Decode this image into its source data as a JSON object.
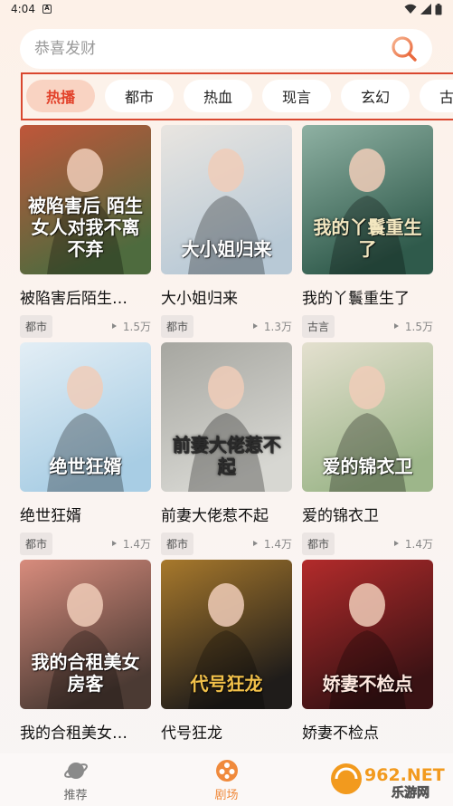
{
  "status_bar": {
    "time": "4:04"
  },
  "search": {
    "placeholder": "恭喜发财"
  },
  "tabs": [
    "热播",
    "都市",
    "热血",
    "现言",
    "玄幻",
    "古言"
  ],
  "dramas": [
    {
      "title": "被陷害后陌生…",
      "tag": "都市",
      "plays": "1.5万",
      "poster_text": "被陷害后 陌生女人对我不离不弃",
      "colors": [
        "#4e6b3e",
        "#c0563a"
      ],
      "text_color": "#ffffff"
    },
    {
      "title": "大小姐归来",
      "tag": "都市",
      "plays": "1.3万",
      "poster_text": "大小姐归来",
      "colors": [
        "#b8c9d6",
        "#e9e5e0"
      ],
      "text_color": "#ffffff"
    },
    {
      "title": "我的丫鬟重生了",
      "tag": "古言",
      "plays": "1.5万",
      "poster_text": "我的丫鬟重生了",
      "colors": [
        "#2f5a4b",
        "#8fb1a3"
      ],
      "text_color": "#f3e7c0"
    },
    {
      "title": "绝世狂婿",
      "tag": "都市",
      "plays": "1.4万",
      "poster_text": "绝世狂婿",
      "colors": [
        "#a8cde4",
        "#e3eef5"
      ],
      "text_color": "#ffffff"
    },
    {
      "title": "前妻大佬惹不起",
      "tag": "都市",
      "plays": "1.4万",
      "poster_text": "前妻大佬惹不起",
      "colors": [
        "#d7d7d2",
        "#a6a6a0"
      ],
      "text_color": "#2b2b2b"
    },
    {
      "title": "爱的锦衣卫",
      "tag": "都市",
      "plays": "1.4万",
      "poster_text": "爱的锦衣卫",
      "colors": [
        "#9db68a",
        "#e4e0cf"
      ],
      "text_color": "#ffffff"
    },
    {
      "title": "我的合租美女…",
      "tag": "",
      "plays": "",
      "poster_text": "我的合租美女房客",
      "colors": [
        "#4b3a33",
        "#d88c7d"
      ],
      "text_color": "#ffffff"
    },
    {
      "title": "代号狂龙",
      "tag": "",
      "plays": "",
      "poster_text": "代号狂龙",
      "colors": [
        "#1f1c1a",
        "#a8792c"
      ],
      "text_color": "#f2c14a"
    },
    {
      "title": "娇妻不检点",
      "tag": "",
      "plays": "",
      "poster_text": "娇妻不检点",
      "colors": [
        "#3a1214",
        "#b32b2b"
      ],
      "text_color": "#ffe9e0"
    }
  ],
  "nav": [
    {
      "label": "推荐",
      "icon": "planet-icon",
      "active": false
    },
    {
      "label": "剧场",
      "icon": "film-reel-icon",
      "active": true
    }
  ],
  "watermark": {
    "text": "962.NET",
    "subtext": "乐游网"
  }
}
